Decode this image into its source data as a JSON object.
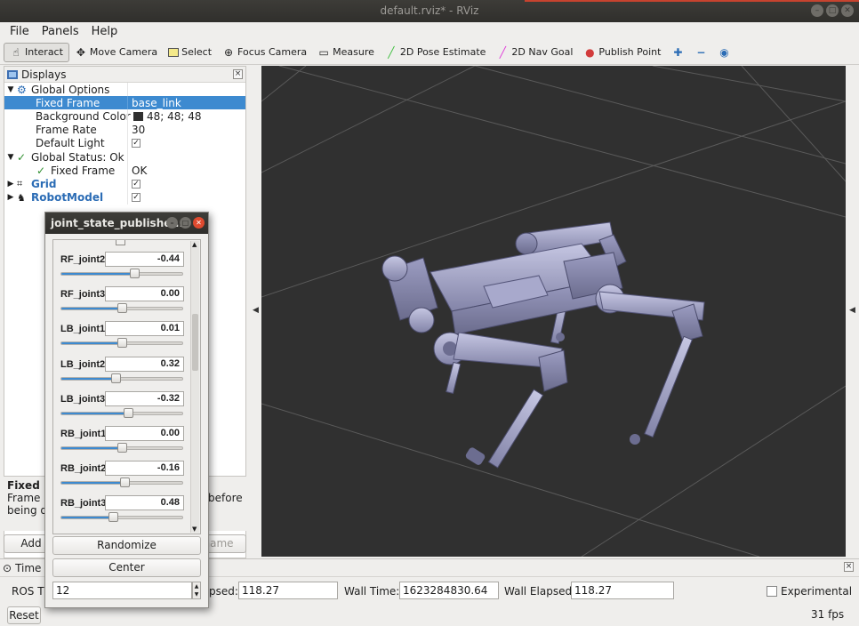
{
  "window": {
    "title": "default.rviz* - RViz"
  },
  "menu": [
    "File",
    "Panels",
    "Help"
  ],
  "toolbar": {
    "interact": "Interact",
    "move_camera": "Move Camera",
    "select": "Select",
    "focus_camera": "Focus Camera",
    "measure": "Measure",
    "pose_estimate": "2D Pose Estimate",
    "nav_goal": "2D Nav Goal",
    "publish_point": "Publish Point",
    "pose_estimate_color": "#3fbf3f",
    "nav_goal_color": "#e03bd8",
    "publish_point_color": "#d23b3b"
  },
  "displays": {
    "title": "Displays",
    "rows": [
      {
        "label": "Global Options",
        "value": ""
      },
      {
        "label": "Fixed Frame",
        "value": "base_link"
      },
      {
        "label": "Background Color",
        "value": "48; 48; 48"
      },
      {
        "label": "Frame Rate",
        "value": "30"
      },
      {
        "label": "Default Light",
        "value": ""
      },
      {
        "label": "Global Status: Ok",
        "value": ""
      },
      {
        "label": "Fixed Frame",
        "value": "OK"
      },
      {
        "label": "Grid",
        "value": ""
      },
      {
        "label": "RobotModel",
        "value": ""
      }
    ],
    "desc_title": "Fixed Fr",
    "desc_line1": "Frame i",
    "desc_line1_tail": "before",
    "desc_line2": "being di",
    "add_label": "Add",
    "rename_label": "name"
  },
  "popup": {
    "title": "joint_state_publishe...",
    "joints": [
      {
        "name": "RF_joint2",
        "value": "-0.44",
        "level": 0.6
      },
      {
        "name": "RF_joint3",
        "value": "0.00",
        "level": 0.5
      },
      {
        "name": "LB_joint1",
        "value": "0.01",
        "level": 0.5
      },
      {
        "name": "LB_joint2",
        "value": "0.32",
        "level": 0.45
      },
      {
        "name": "LB_joint3",
        "value": "-0.32",
        "level": 0.55
      },
      {
        "name": "RB_joint1",
        "value": "0.00",
        "level": 0.5
      },
      {
        "name": "RB_joint2",
        "value": "-0.16",
        "level": 0.52
      },
      {
        "name": "RB_joint3",
        "value": "0.48",
        "level": 0.43
      }
    ],
    "randomize": "Randomize",
    "center": "Center",
    "spin_value": "12"
  },
  "time": {
    "title": "Time",
    "ros_time_label": "ROS Ti",
    "ros_elapsed_label": "psed:",
    "ros_elapsed_value": "118.27",
    "wall_time_label": "Wall Time:",
    "wall_time_value": "1623284830.64",
    "wall_elapsed_label": "Wall Elapsed:",
    "wall_elapsed_value": "118.27",
    "experimental": "Experimental",
    "fps": "31 fps",
    "reset": "Reset"
  }
}
